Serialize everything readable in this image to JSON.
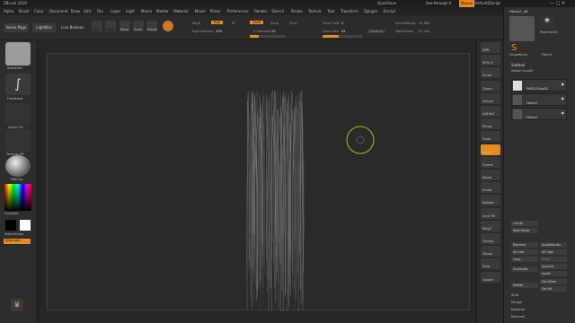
{
  "window": {
    "title": "ZBrush 2019"
  },
  "menu": {
    "items": [
      "Alpha",
      "Brush",
      "Color",
      "Document",
      "Draw",
      "Edit",
      "File",
      "Layer",
      "Light",
      "Macro",
      "Marker",
      "Material",
      "Movie",
      "Picker",
      "Preferences",
      "Render",
      "Stencil",
      "Stroke",
      "Texture",
      "Tool",
      "Transform",
      "Zplugin",
      "Zscript"
    ],
    "quicksave": "QuickSave",
    "see_through": "See-through 0",
    "menus_btn": "Menus",
    "default_zscript": "DefaultZScript"
  },
  "shelf": {
    "home_page": "Home Page",
    "lightbox": "LightBox",
    "live_boolean": "Live Boolean",
    "edit": "Edit",
    "draw": "Draw",
    "move": "Move",
    "scale": "Scale",
    "rotate": "Rotate",
    "mrgb": "Mrgb",
    "rgb": "Rgb",
    "m": "M",
    "zadd": "Zadd",
    "zsub": "Zsub",
    "zcut": "Zcut",
    "rgb_intensity_label": "Rgb Intensity",
    "rgb_intensity_value": "100",
    "z_intensity_label": "Z Intensity",
    "z_intensity_value": "25",
    "focal_shift_label": "Focal Shift",
    "focal_shift_value": "0",
    "draw_size_label": "Draw Size",
    "draw_size_value": "64",
    "dynamic": "Dynamic",
    "active_points_label": "ActivePoints:",
    "active_points_value": "33,080",
    "total_points_label": "TotalPoints:",
    "total_points_value": "67,440"
  },
  "left": {
    "standard_label": "Standard",
    "freehand_label": "FreeHand",
    "alpha_off": "Alpha Off",
    "texture_off": "Texture Off",
    "matcap_label": "MatCap",
    "gradient": "Gradient",
    "switch_color": "SwitchColor",
    "alternate": "Alternate"
  },
  "right_tools": [
    "BPR",
    "SPix 3",
    "Scroll",
    "Zoom",
    "Actual",
    "AAHalf",
    "Persp",
    "Floor",
    "Local",
    "Frame",
    "Move",
    "Scale",
    "Rotate",
    "Line Fill",
    "PolyF",
    "Transp",
    "Ghost",
    "Solo",
    "Xpose"
  ],
  "subtool": {
    "tool_name": "Fibers2_48",
    "brush1": "Fibers2",
    "brush2": "SimpleBrush",
    "brush3": "Polymesh3D",
    "brush4": "Fibers2",
    "header": "Subtool",
    "visible_count_label": "Visible Count",
    "visible_count": "3",
    "items": [
      "PM3D_Ring3D",
      "Fibers1",
      "Fibers2"
    ],
    "list_all": "List All",
    "new_folder": "New Folder",
    "rename": "Rename",
    "auto_reorder": "AutoReorder",
    "all_low": "All Low",
    "all_high": "All High",
    "copy": "Copy",
    "paste": "Paste",
    "duplicate": "Duplicate",
    "append": "Append",
    "insert": "Insert",
    "delete": "Delete",
    "del_other": "Del Other",
    "del_all": "Del All",
    "split": "Split",
    "merge": "Merge",
    "boolean": "Boolean",
    "remesh": "Remesh"
  },
  "colors": {
    "accent": "#e88b1e",
    "bg": "#282828"
  }
}
